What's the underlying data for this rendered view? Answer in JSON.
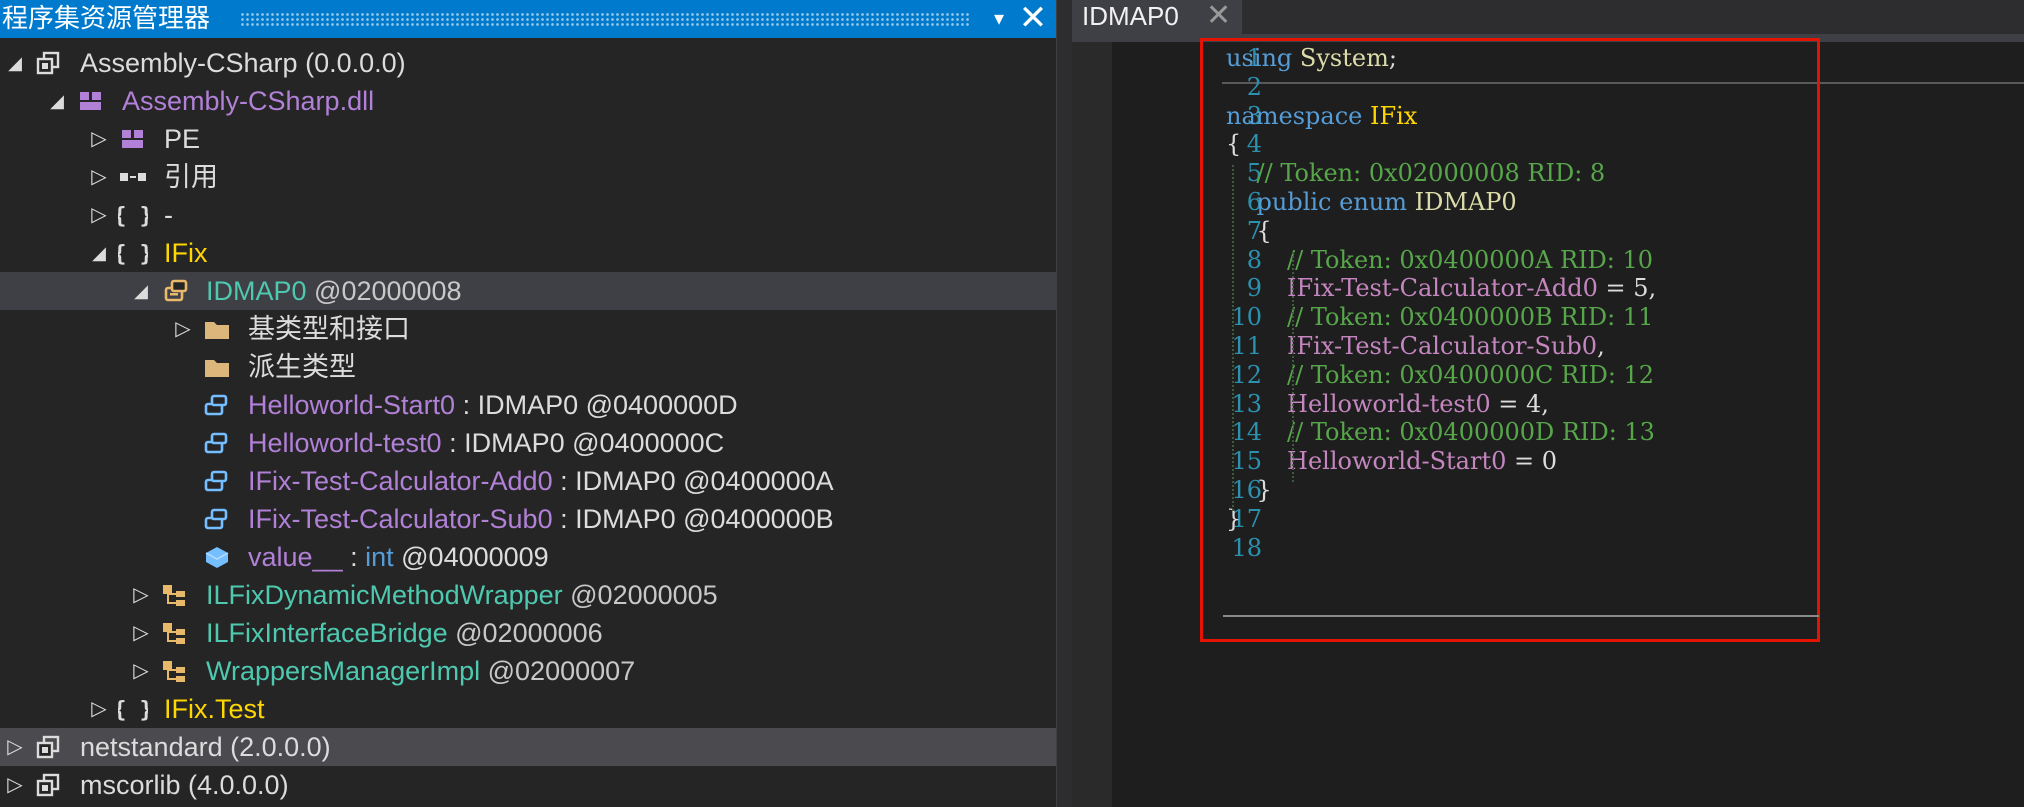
{
  "assembly_explorer": {
    "title": "程序集资源管理器",
    "close_glyph": "✕",
    "dropdown_glyph": "▾",
    "tree": [
      {
        "kind": "assembly",
        "name": "Assembly-CSharp",
        "ver": " (0.0.0.0)",
        "expanded": true
      },
      {
        "kind": "module",
        "name": "Assembly-CSharp.dll",
        "expanded": true
      },
      {
        "kind": "pe",
        "name": "PE",
        "expanded": false
      },
      {
        "kind": "refs",
        "name": "引用",
        "expanded": false
      },
      {
        "kind": "ns",
        "name": "-",
        "expanded": false
      },
      {
        "kind": "ns",
        "name": "IFix",
        "expanded": true
      },
      {
        "kind": "enum",
        "name": "IDMAP0",
        "token": " @02000008",
        "expanded": true
      },
      {
        "kind": "folder",
        "name": "基类型和接口",
        "expanded": false
      },
      {
        "kind": "folder",
        "name": "派生类型"
      },
      {
        "kind": "field",
        "name": "Helloworld-Start0",
        "type": " : IDMAP0 @0400000D"
      },
      {
        "kind": "field",
        "name": "Helloworld-test0",
        "type": " : IDMAP0 @0400000C"
      },
      {
        "kind": "field",
        "name": "IFix-Test-Calculator-Add0",
        "type": " : IDMAP0 @0400000A"
      },
      {
        "kind": "field",
        "name": "IFix-Test-Calculator-Sub0",
        "type": " : IDMAP0 @0400000B"
      },
      {
        "kind": "value",
        "name": "value__",
        "sep": " : ",
        "kw": "int",
        "token": " @04000009"
      },
      {
        "kind": "class",
        "name": "ILFixDynamicMethodWrapper",
        "token": " @02000005",
        "expanded": false
      },
      {
        "kind": "class",
        "name": "ILFixInterfaceBridge",
        "token": " @02000006",
        "expanded": false
      },
      {
        "kind": "class",
        "name": "WrappersManagerImpl",
        "token": " @02000007",
        "expanded": false
      },
      {
        "kind": "ns",
        "name": "IFix.Test",
        "expanded": false
      },
      {
        "kind": "assembly",
        "name": "netstandard",
        "ver": " (2.0.0.0)",
        "expanded": false
      },
      {
        "kind": "assembly",
        "name": "mscorlib",
        "ver": " (4.0.0.0)",
        "expanded": false
      }
    ]
  },
  "editor": {
    "tab": {
      "label": "IDMAP0",
      "close_glyph": "✕"
    },
    "lines": [
      {
        "n": "1",
        "seg": [
          [
            "kw",
            "using"
          ],
          [
            "pl",
            " "
          ],
          [
            "tyg",
            "System"
          ],
          [
            "pl",
            ";"
          ]
        ]
      },
      {
        "n": "2",
        "seg": []
      },
      {
        "n": "3",
        "seg": [
          [
            "kw",
            "namespace"
          ],
          [
            "pl",
            " "
          ],
          [
            "ty",
            "IFix"
          ]
        ]
      },
      {
        "n": "4",
        "seg": [
          [
            "pl",
            "{"
          ]
        ]
      },
      {
        "n": "5",
        "seg": [
          [
            "pl",
            "    "
          ],
          [
            "cm",
            "// Token: 0x02000008 RID: 8"
          ]
        ]
      },
      {
        "n": "6",
        "seg": [
          [
            "pl",
            "    "
          ],
          [
            "kw",
            "public"
          ],
          [
            "pl",
            " "
          ],
          [
            "kw",
            "enum"
          ],
          [
            "pl",
            " "
          ],
          [
            "tyg",
            "IDMAP0"
          ]
        ]
      },
      {
        "n": "7",
        "seg": [
          [
            "pl",
            "    {"
          ]
        ]
      },
      {
        "n": "8",
        "seg": [
          [
            "pl",
            "        "
          ],
          [
            "cm",
            "// Token: 0x0400000A RID: 10"
          ]
        ]
      },
      {
        "n": "9",
        "seg": [
          [
            "pl",
            "        "
          ],
          [
            "em",
            "IFix-Test-Calculator-Add0"
          ],
          [
            "pl",
            " = 5,"
          ]
        ]
      },
      {
        "n": "10",
        "seg": [
          [
            "pl",
            "        "
          ],
          [
            "cm",
            "// Token: 0x0400000B RID: 11"
          ]
        ]
      },
      {
        "n": "11",
        "seg": [
          [
            "pl",
            "        "
          ],
          [
            "em",
            "IFix-Test-Calculator-Sub0"
          ],
          [
            "pl",
            ","
          ]
        ]
      },
      {
        "n": "12",
        "seg": [
          [
            "pl",
            "        "
          ],
          [
            "cm",
            "// Token: 0x0400000C RID: 12"
          ]
        ]
      },
      {
        "n": "13",
        "seg": [
          [
            "pl",
            "        "
          ],
          [
            "em",
            "Helloworld-test0"
          ],
          [
            "pl",
            " = 4,"
          ]
        ]
      },
      {
        "n": "14",
        "seg": [
          [
            "pl",
            "        "
          ],
          [
            "cm",
            "// Token: 0x0400000D RID: 13"
          ]
        ]
      },
      {
        "n": "15",
        "seg": [
          [
            "pl",
            "        "
          ],
          [
            "em",
            "Helloworld-Start0"
          ],
          [
            "pl",
            " = 0"
          ]
        ]
      },
      {
        "n": "16",
        "seg": [
          [
            "pl",
            "    }"
          ]
        ]
      },
      {
        "n": "17",
        "seg": [
          [
            "pl",
            "}"
          ]
        ]
      },
      {
        "n": "18",
        "seg": []
      }
    ]
  },
  "colors": {
    "header_blue": "#007acc",
    "highlight_red": "#e51400",
    "line_number": "#2b91af",
    "comment": "#57a64a",
    "keyword": "#569cd6",
    "enum_member": "#c586c0",
    "namespace": "#ffd700"
  }
}
